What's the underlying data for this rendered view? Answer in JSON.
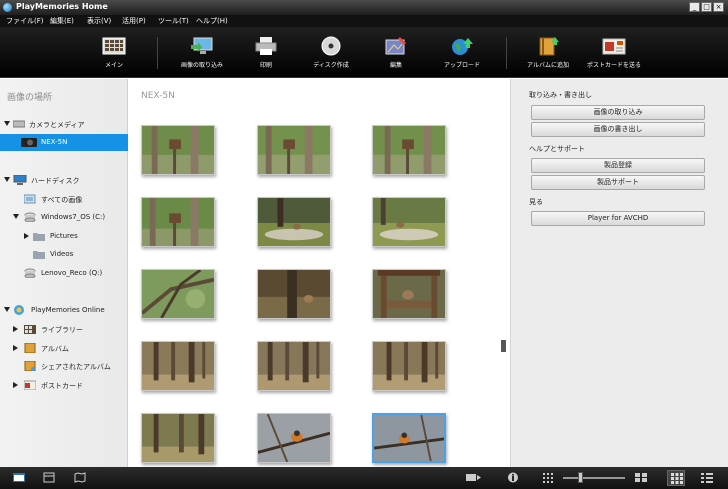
{
  "window": {
    "title": "PlayMemories Home",
    "buttons": [
      "_",
      "□",
      "×"
    ]
  },
  "menu": [
    "ファイル(F)",
    "編集(E)",
    "表示(V)",
    "活用(P)",
    "ツール(T)",
    "ヘルプ(H)"
  ],
  "toolbar": [
    {
      "label": "メイン",
      "icon": "main-view-icon"
    },
    {
      "label": "画像の取り込み",
      "icon": "import-icon"
    },
    {
      "label": "印刷",
      "icon": "printer-icon"
    },
    {
      "label": "ディスク作成",
      "icon": "disc-icon"
    },
    {
      "label": "編集",
      "icon": "edit-icon"
    },
    {
      "label": "アップロード",
      "icon": "upload-globe-icon"
    },
    {
      "label": "アルバムに追加",
      "icon": "album-add-icon"
    },
    {
      "label": "ポストカードを送る",
      "icon": "postcard-icon"
    }
  ],
  "sidebar": {
    "heading": "画像の場所",
    "items": [
      {
        "label": "カメラとメディア",
        "icon": "camera-media-icon"
      },
      {
        "label": "NEX-5N",
        "icon": "camera-icon"
      },
      {
        "label": "ハードディスク",
        "icon": "computer-icon"
      },
      {
        "label": "すべての画像",
        "icon": "all-images-icon"
      },
      {
        "label": "Windows7_OS (C:)",
        "icon": "drive-icon"
      },
      {
        "label": "Pictures",
        "icon": "folder-icon"
      },
      {
        "label": "Videos",
        "icon": "folder-icon"
      },
      {
        "label": "Lenovo_Reco (Q:)",
        "icon": "drive-icon"
      },
      {
        "label": "PlayMemories Online",
        "icon": "playmemories-online-icon"
      },
      {
        "label": "ライブラリー",
        "icon": "library-icon"
      },
      {
        "label": "アルバム",
        "icon": "album-icon"
      },
      {
        "label": "シェアされたアルバム",
        "icon": "shared-album-icon"
      },
      {
        "label": "ポストカード",
        "icon": "postcard-icon"
      }
    ]
  },
  "main": {
    "location": "NEX-5N",
    "thumbnails": [
      "forest-birdhouse",
      "forest-birdhouse",
      "forest-birdhouse",
      "forest-birdhouse",
      "squirrel-moss",
      "squirrel-moss",
      "tree-branches",
      "squirrel-rock",
      "squirrel-feeder",
      "forest-trunks",
      "forest-trunks",
      "forest-trunks",
      "forest-trunks",
      "bird-branch",
      "bird-branch"
    ]
  },
  "right_panel": {
    "import_export": {
      "title": "取り込み・書き出し",
      "buttons": [
        "画像の取り込み",
        "画像の書き出し"
      ]
    },
    "help": {
      "title": "ヘルプとサポート",
      "buttons": [
        "製品登録",
        "製品サポート"
      ]
    },
    "view": {
      "title": "見る",
      "buttons": [
        "Player for AVCHD"
      ]
    }
  },
  "bottombar": {
    "left": [
      "folder-view-icon",
      "calendar-view-icon",
      "map-view-icon"
    ],
    "right": [
      "filter-icon",
      "info-icon",
      "zoom-small-icon",
      "zoom-slider",
      "zoom-large-icon",
      "grid-view-icon",
      "detail-view-icon"
    ]
  },
  "colors": {
    "accent": "#1591e6",
    "toolbar_bg": "#000000",
    "panel_bg": "#ececec"
  }
}
